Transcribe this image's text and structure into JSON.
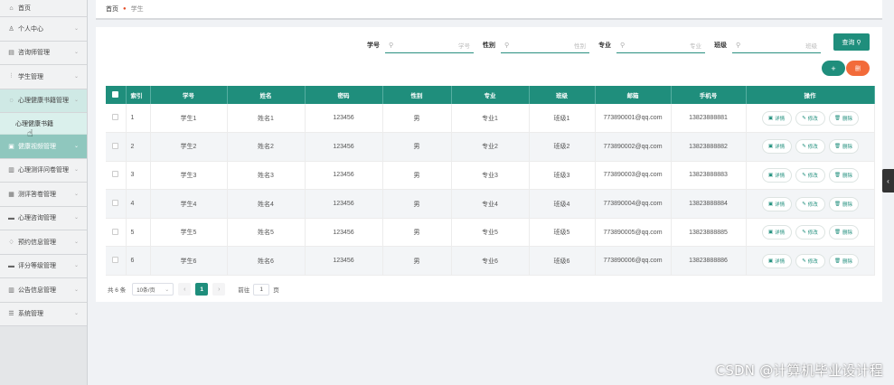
{
  "sidebar": {
    "home": "首页",
    "items": [
      {
        "label": "个人中心",
        "icon": "user-icon"
      },
      {
        "label": "咨询师管理",
        "icon": "list-icon"
      },
      {
        "label": "学生管理",
        "icon": "chart-icon"
      },
      {
        "label": "心理健康书籍管理",
        "icon": "chat-icon"
      },
      {
        "label": "健康视频管理",
        "icon": "video-icon"
      },
      {
        "label": "心理测评问卷管理",
        "icon": "doc-icon"
      },
      {
        "label": "测评答卷管理",
        "icon": "grid-icon"
      },
      {
        "label": "心理咨询管理",
        "icon": "message-icon"
      },
      {
        "label": "预约信息管理",
        "icon": "bell-icon"
      },
      {
        "label": "评分等级管理",
        "icon": "star-icon"
      },
      {
        "label": "公告信息管理",
        "icon": "notice-icon"
      },
      {
        "label": "系统管理",
        "icon": "settings-icon"
      }
    ],
    "sub_item": "心理健康书籍"
  },
  "breadcrumb": {
    "home": "首页",
    "current": "学生"
  },
  "filters": [
    {
      "label": "学号",
      "placeholder": "学号"
    },
    {
      "label": "性别",
      "placeholder": "性别"
    },
    {
      "label": "专业",
      "placeholder": "专业"
    },
    {
      "label": "班级",
      "placeholder": "班级"
    }
  ],
  "buttons": {
    "query": "查询",
    "add": "+",
    "delete": "删"
  },
  "table": {
    "headers": [
      "索引",
      "学号",
      "姓名",
      "密码",
      "性别",
      "专业",
      "班级",
      "邮箱",
      "手机号",
      "操作"
    ],
    "rows": [
      {
        "idx": "1",
        "sno": "学生1",
        "name": "姓名1",
        "pwd": "123456",
        "sex": "男",
        "major": "专业1",
        "cls": "班级1",
        "email": "773890001@qq.com",
        "phone": "13823888881"
      },
      {
        "idx": "2",
        "sno": "学生2",
        "name": "姓名2",
        "pwd": "123456",
        "sex": "男",
        "major": "专业2",
        "cls": "班级2",
        "email": "773890002@qq.com",
        "phone": "13823888882"
      },
      {
        "idx": "3",
        "sno": "学生3",
        "name": "姓名3",
        "pwd": "123456",
        "sex": "男",
        "major": "专业3",
        "cls": "班级3",
        "email": "773890003@qq.com",
        "phone": "13823888883"
      },
      {
        "idx": "4",
        "sno": "学生4",
        "name": "姓名4",
        "pwd": "123456",
        "sex": "男",
        "major": "专业4",
        "cls": "班级4",
        "email": "773890004@qq.com",
        "phone": "13823888884"
      },
      {
        "idx": "5",
        "sno": "学生5",
        "name": "姓名5",
        "pwd": "123456",
        "sex": "男",
        "major": "专业5",
        "cls": "班级5",
        "email": "773890005@qq.com",
        "phone": "13823888885"
      },
      {
        "idx": "6",
        "sno": "学生6",
        "name": "姓名6",
        "pwd": "123456",
        "sex": "男",
        "major": "专业6",
        "cls": "班级6",
        "email": "773890006@qq.com",
        "phone": "13823888886"
      }
    ],
    "actions": {
      "detail": "详情",
      "edit": "修改",
      "delete": "删除"
    }
  },
  "pager": {
    "total": "共 6 条",
    "page_size": "10条/页",
    "current": "1",
    "goto": "前往",
    "goto_value": "1",
    "page_unit": "页"
  },
  "watermark": "CSDN @计算机毕业设计程"
}
